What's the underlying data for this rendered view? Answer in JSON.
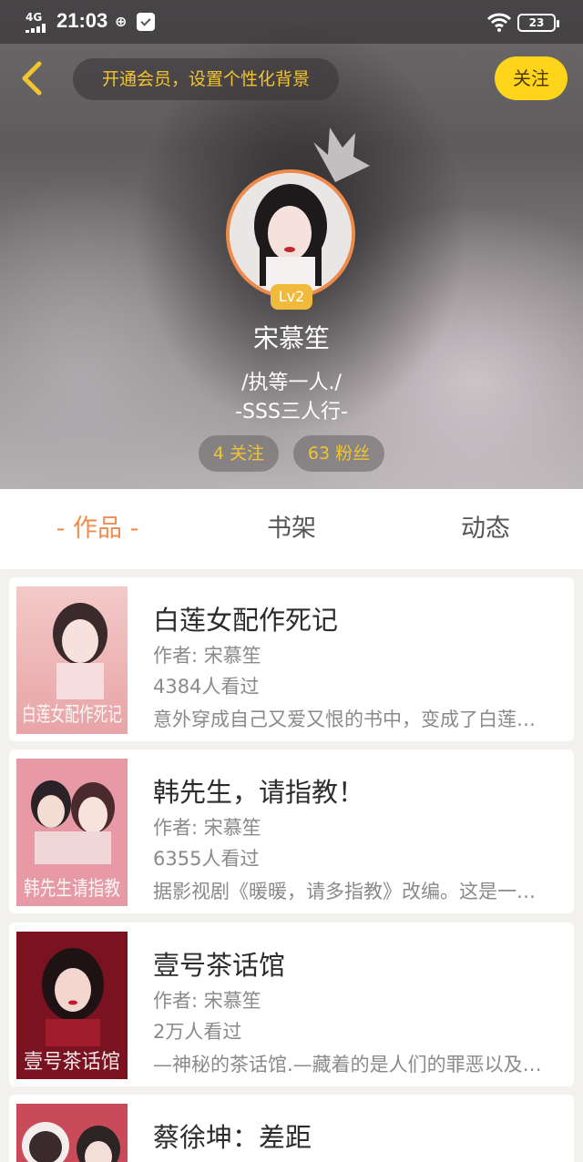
{
  "status_bar": {
    "network": "4G",
    "time": "21:03",
    "notification_glyph": "⊕",
    "battery": "23"
  },
  "header": {
    "vip_prompt": "开通会员，设置个性化背景",
    "follow_label": "关注",
    "level": "Lv2",
    "username": "宋慕笙",
    "bio_line1": "/执等一人./",
    "bio_line2": "-SSS三人行-",
    "following": "4 关注",
    "fans": "63 粉丝"
  },
  "tabs": [
    "- 作品 -",
    "书架",
    "动态"
  ],
  "books": [
    {
      "title": "白莲女配作死记",
      "author": "作者: 宋慕笙",
      "views": "4384人看过",
      "desc": "意外穿成自己又爱又恨的书中，变成了白莲女配的我…",
      "cover_text": "白莲女配作死记"
    },
    {
      "title": "韩先生，请指教！",
      "author": "作者: 宋慕笙",
      "views": "6355人看过",
      "desc": "据影视剧《暖暖，请多指教》改编。这是一段…",
      "cover_text": "韩先生请指教"
    },
    {
      "title": "壹号茶话馆",
      "author": "作者: 宋慕笙",
      "views": "2万人看过",
      "desc": "—神秘的茶话馆.—藏着的是人们的罪恶以及…",
      "cover_text": "壹号茶话馆"
    },
    {
      "title": "蔡徐坤：差距",
      "author": "作者: 宋慕笙",
      "views": "",
      "desc": "",
      "cover_text": ""
    }
  ],
  "colors": {
    "accent_orange": "#ef8c4e",
    "vip_gold": "#f2c530",
    "follow_yellow": "#ffd51c",
    "level_badge": "#f0ba3c"
  }
}
